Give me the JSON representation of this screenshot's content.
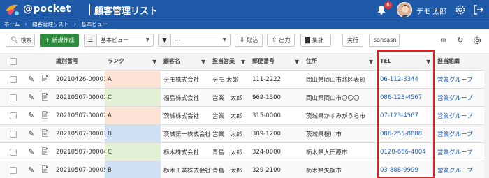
{
  "header": {
    "logo_text": "@pocket",
    "app_title": "顧客管理リスト",
    "notification_count": "6",
    "user_name": "デモ 太郎"
  },
  "breadcrumb": [
    "ホーム",
    "›",
    "顧客管理リスト",
    "›",
    "基本ビュー"
  ],
  "toolbar": {
    "search_label": "検索",
    "new_label": "新規作成",
    "view_select": "基本ビュー",
    "filter_select": "---",
    "import_label": "取込",
    "export_label": "出力",
    "aggregate_label": "集計",
    "execute_label": "実行",
    "sansasn_label": "sansasn"
  },
  "table": {
    "columns": [
      "識別番号",
      "ランク",
      "顧客名",
      "担当営業",
      "郵便番号",
      "住所",
      "TEL",
      "担当組織"
    ],
    "rows": [
      {
        "id": "20210426-00001",
        "rank": "A",
        "customer": "デモ株式会社",
        "sales": "デモ 太郎",
        "zip": "111-2222",
        "address": "岡山県岡山市北区表町",
        "tel": "06-112-3344",
        "dept": "営業グループ"
      },
      {
        "id": "20210507-00001",
        "rank": "C",
        "customer": "福島株式会社",
        "sales": "営業　太郎",
        "zip": "969-1300",
        "address": "岡山県岡山市〇〇〇",
        "tel": "086-123-4567",
        "dept": "営業グループ"
      },
      {
        "id": "20210507-00002",
        "rank": "A",
        "customer": "茨城株式会社",
        "sales": "営業　太郎",
        "zip": "315-0000",
        "address": "茨城県かすみがうら市",
        "tel": "07-123-4567",
        "dept": "営業グループ"
      },
      {
        "id": "20210507-00003",
        "rank": "B",
        "customer": "茨城第一株式会社",
        "sales": "営業　太郎",
        "zip": "309-1200",
        "address": "茨城県桜川市",
        "tel": "086-255-8888",
        "dept": "営業グループ"
      },
      {
        "id": "20210507-00004",
        "rank": "C",
        "customer": "栃木株式会社",
        "sales": "青島　太郎",
        "zip": "324-0000",
        "address": "栃木県大田原市",
        "tel": "0120-666-4004",
        "dept": "営業グループ"
      },
      {
        "id": "20210507-00005",
        "rank": "B",
        "customer": "栃木工業株式会社",
        "sales": "青島　太郎",
        "zip": "329-2100",
        "address": "栃木県矢板市",
        "tel": "03-888-9999",
        "dept": "営業グループ"
      }
    ]
  },
  "colors": {
    "header_bg": "#1f5aa8",
    "new_button": "#2e8b3d",
    "rank_a": "#fde2d6",
    "rank_b": "#cfe0f2",
    "rank_c": "#e3f0d6",
    "link": "#1f62c2",
    "highlight": "#e0201a"
  }
}
